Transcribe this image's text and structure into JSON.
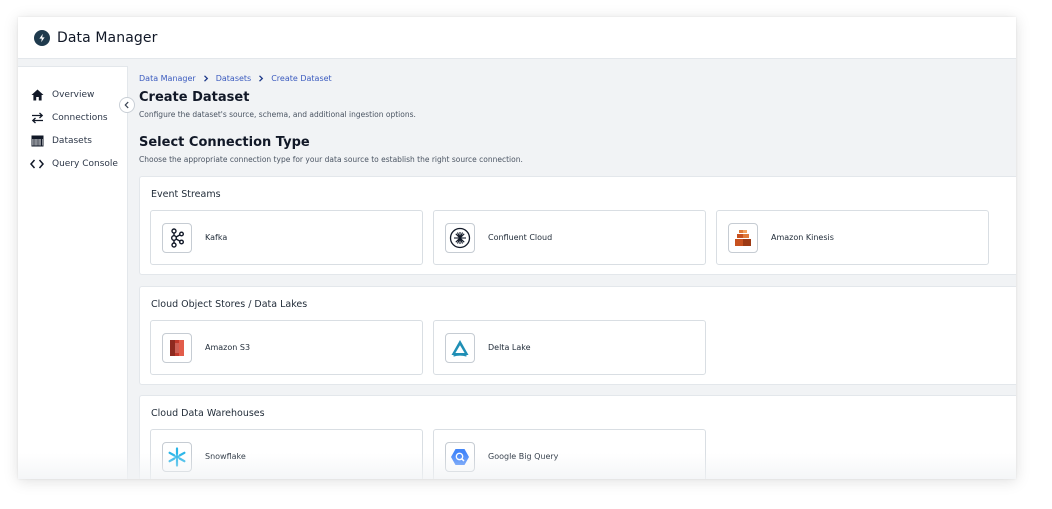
{
  "app": {
    "title": "Data Manager"
  },
  "sidebar": {
    "items": [
      {
        "label": "Overview",
        "icon": "home-icon"
      },
      {
        "label": "Connections",
        "icon": "arrows-exchange-icon"
      },
      {
        "label": "Datasets",
        "icon": "table-icon"
      },
      {
        "label": "Query Console",
        "icon": "code-brackets-icon"
      }
    ]
  },
  "breadcrumb": {
    "items": [
      "Data Manager",
      "Datasets",
      "Create Dataset"
    ]
  },
  "page": {
    "title": "Create Dataset",
    "subtitle": "Configure the dataset's source, schema, and additional ingestion options."
  },
  "selection": {
    "title": "Select Connection Type",
    "subtitle": "Choose the appropriate connection type for your data source to establish the right source connection."
  },
  "groups": [
    {
      "title": "Event Streams",
      "cards": [
        {
          "label": "Kafka",
          "icon": "kafka-icon"
        },
        {
          "label": "Confluent Cloud",
          "icon": "confluent-icon"
        },
        {
          "label": "Amazon Kinesis",
          "icon": "kinesis-icon"
        }
      ]
    },
    {
      "title": "Cloud Object Stores / Data Lakes",
      "cards": [
        {
          "label": "Amazon S3",
          "icon": "s3-icon"
        },
        {
          "label": "Delta Lake",
          "icon": "delta-lake-icon"
        }
      ]
    },
    {
      "title": "Cloud Data Warehouses",
      "cards": [
        {
          "label": "Snowflake",
          "icon": "snowflake-icon"
        },
        {
          "label": "Google Big Query",
          "icon": "bigquery-icon"
        }
      ]
    }
  ],
  "colors": {
    "link": "#3b5bbf",
    "kinesis": "#c7511f",
    "s3": "#c0392b",
    "delta": "#1f8fb5",
    "snowflake": "#29b5e8",
    "bigquery": "#4386fa"
  }
}
